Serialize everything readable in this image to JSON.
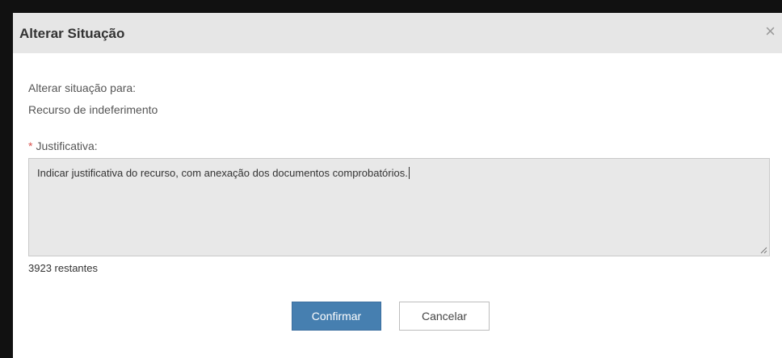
{
  "dialog": {
    "title": "Alterar Situação",
    "close_symbol": "×"
  },
  "form": {
    "change_to_label": "Alterar situação para:",
    "change_to_value": "Recurso de indeferimento",
    "required_mark": "*",
    "justification_label": "Justificativa:",
    "justification_value": "Indicar justificativa do recurso, com anexação dos documentos comprobatórios.",
    "remaining_chars": "3923 restantes"
  },
  "buttons": {
    "confirm_label": "Confirmar",
    "cancel_label": "Cancelar"
  },
  "colors": {
    "header_bg": "#e6e6e6",
    "textarea_bg": "#e8e8e8",
    "confirm_bg": "#467fb0",
    "required_mark": "#d9534f"
  },
  "icons": {
    "close": "close-icon",
    "resize": "resize-handle-icon"
  }
}
